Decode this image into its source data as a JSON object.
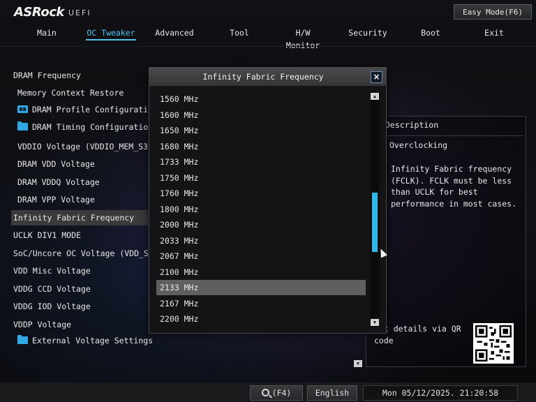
{
  "brand": {
    "logo": "ASRock",
    "sub": "UEFI"
  },
  "easy_mode_label": "Easy Mode(F6)",
  "tabs": [
    {
      "label": "Main",
      "active": false
    },
    {
      "label": "OC Tweaker",
      "active": true
    },
    {
      "label": "Advanced",
      "active": false
    },
    {
      "label": "Tool",
      "active": false
    },
    {
      "label": "H/W Monitor",
      "active": false
    },
    {
      "label": "Security",
      "active": false
    },
    {
      "label": "Boot",
      "active": false
    },
    {
      "label": "Exit",
      "active": false
    }
  ],
  "menu": [
    {
      "label": "DRAM Frequency",
      "icon": ""
    },
    {
      "label": "Memory Context Restore",
      "icon": ""
    },
    {
      "label": "DRAM Profile Configuration",
      "icon": "profile-icon"
    },
    {
      "label": "DRAM Timing Configuration",
      "icon": "folder-icon"
    },
    {
      "label": "VDDIO Voltage (VDDIO_MEM_S3)",
      "icon": ""
    },
    {
      "label": "DRAM VDD Voltage",
      "icon": ""
    },
    {
      "label": "DRAM VDDQ Voltage",
      "icon": ""
    },
    {
      "label": "DRAM VPP Voltage",
      "icon": ""
    },
    {
      "label": "Infinity Fabric Frequency",
      "icon": "",
      "selected": true
    },
    {
      "label": "UCLK DIV1 MODE",
      "icon": ""
    },
    {
      "label": "SoC/Uncore OC Voltage (VDD_SOC)",
      "icon": ""
    },
    {
      "label": "VDD Misc Voltage",
      "icon": ""
    },
    {
      "label": "VDDG CCD Voltage",
      "icon": ""
    },
    {
      "label": "VDDG IOD Voltage",
      "icon": ""
    },
    {
      "label": "VDDP Voltage",
      "icon": ""
    },
    {
      "label": "External Voltage Settings",
      "icon": "folder-icon"
    }
  ],
  "description": {
    "header": "Description",
    "title": "Overclocking",
    "text": "Infinity Fabric frequency (FCLK). FCLK must be less than UCLK for best performance in most cases.",
    "qr_text": "Get details via QR code"
  },
  "dialog": {
    "title": "Infinity Fabric Frequency",
    "close_label": "×",
    "options": [
      "1560 MHz",
      "1600 MHz",
      "1650 MHz",
      "1680 MHz",
      "1733 MHz",
      "1750 MHz",
      "1760 MHz",
      "1800 MHz",
      "2000 MHz",
      "2033 MHz",
      "2067 MHz",
      "2100 MHz",
      "2133 MHz",
      "2167 MHz",
      "2200 MHz"
    ],
    "selected": "2133 MHz",
    "scroll": {
      "thumb_start": 0.84,
      "thumb_end": 0.91
    }
  },
  "status": {
    "search_label": "(F4)",
    "language": "English",
    "clock": "Mon 05/12/2025. 21:20:58"
  },
  "colors": {
    "accent": "#4fc1ef",
    "selection": "#5f5f62",
    "scroll_thumb": "#2fb8ec"
  }
}
